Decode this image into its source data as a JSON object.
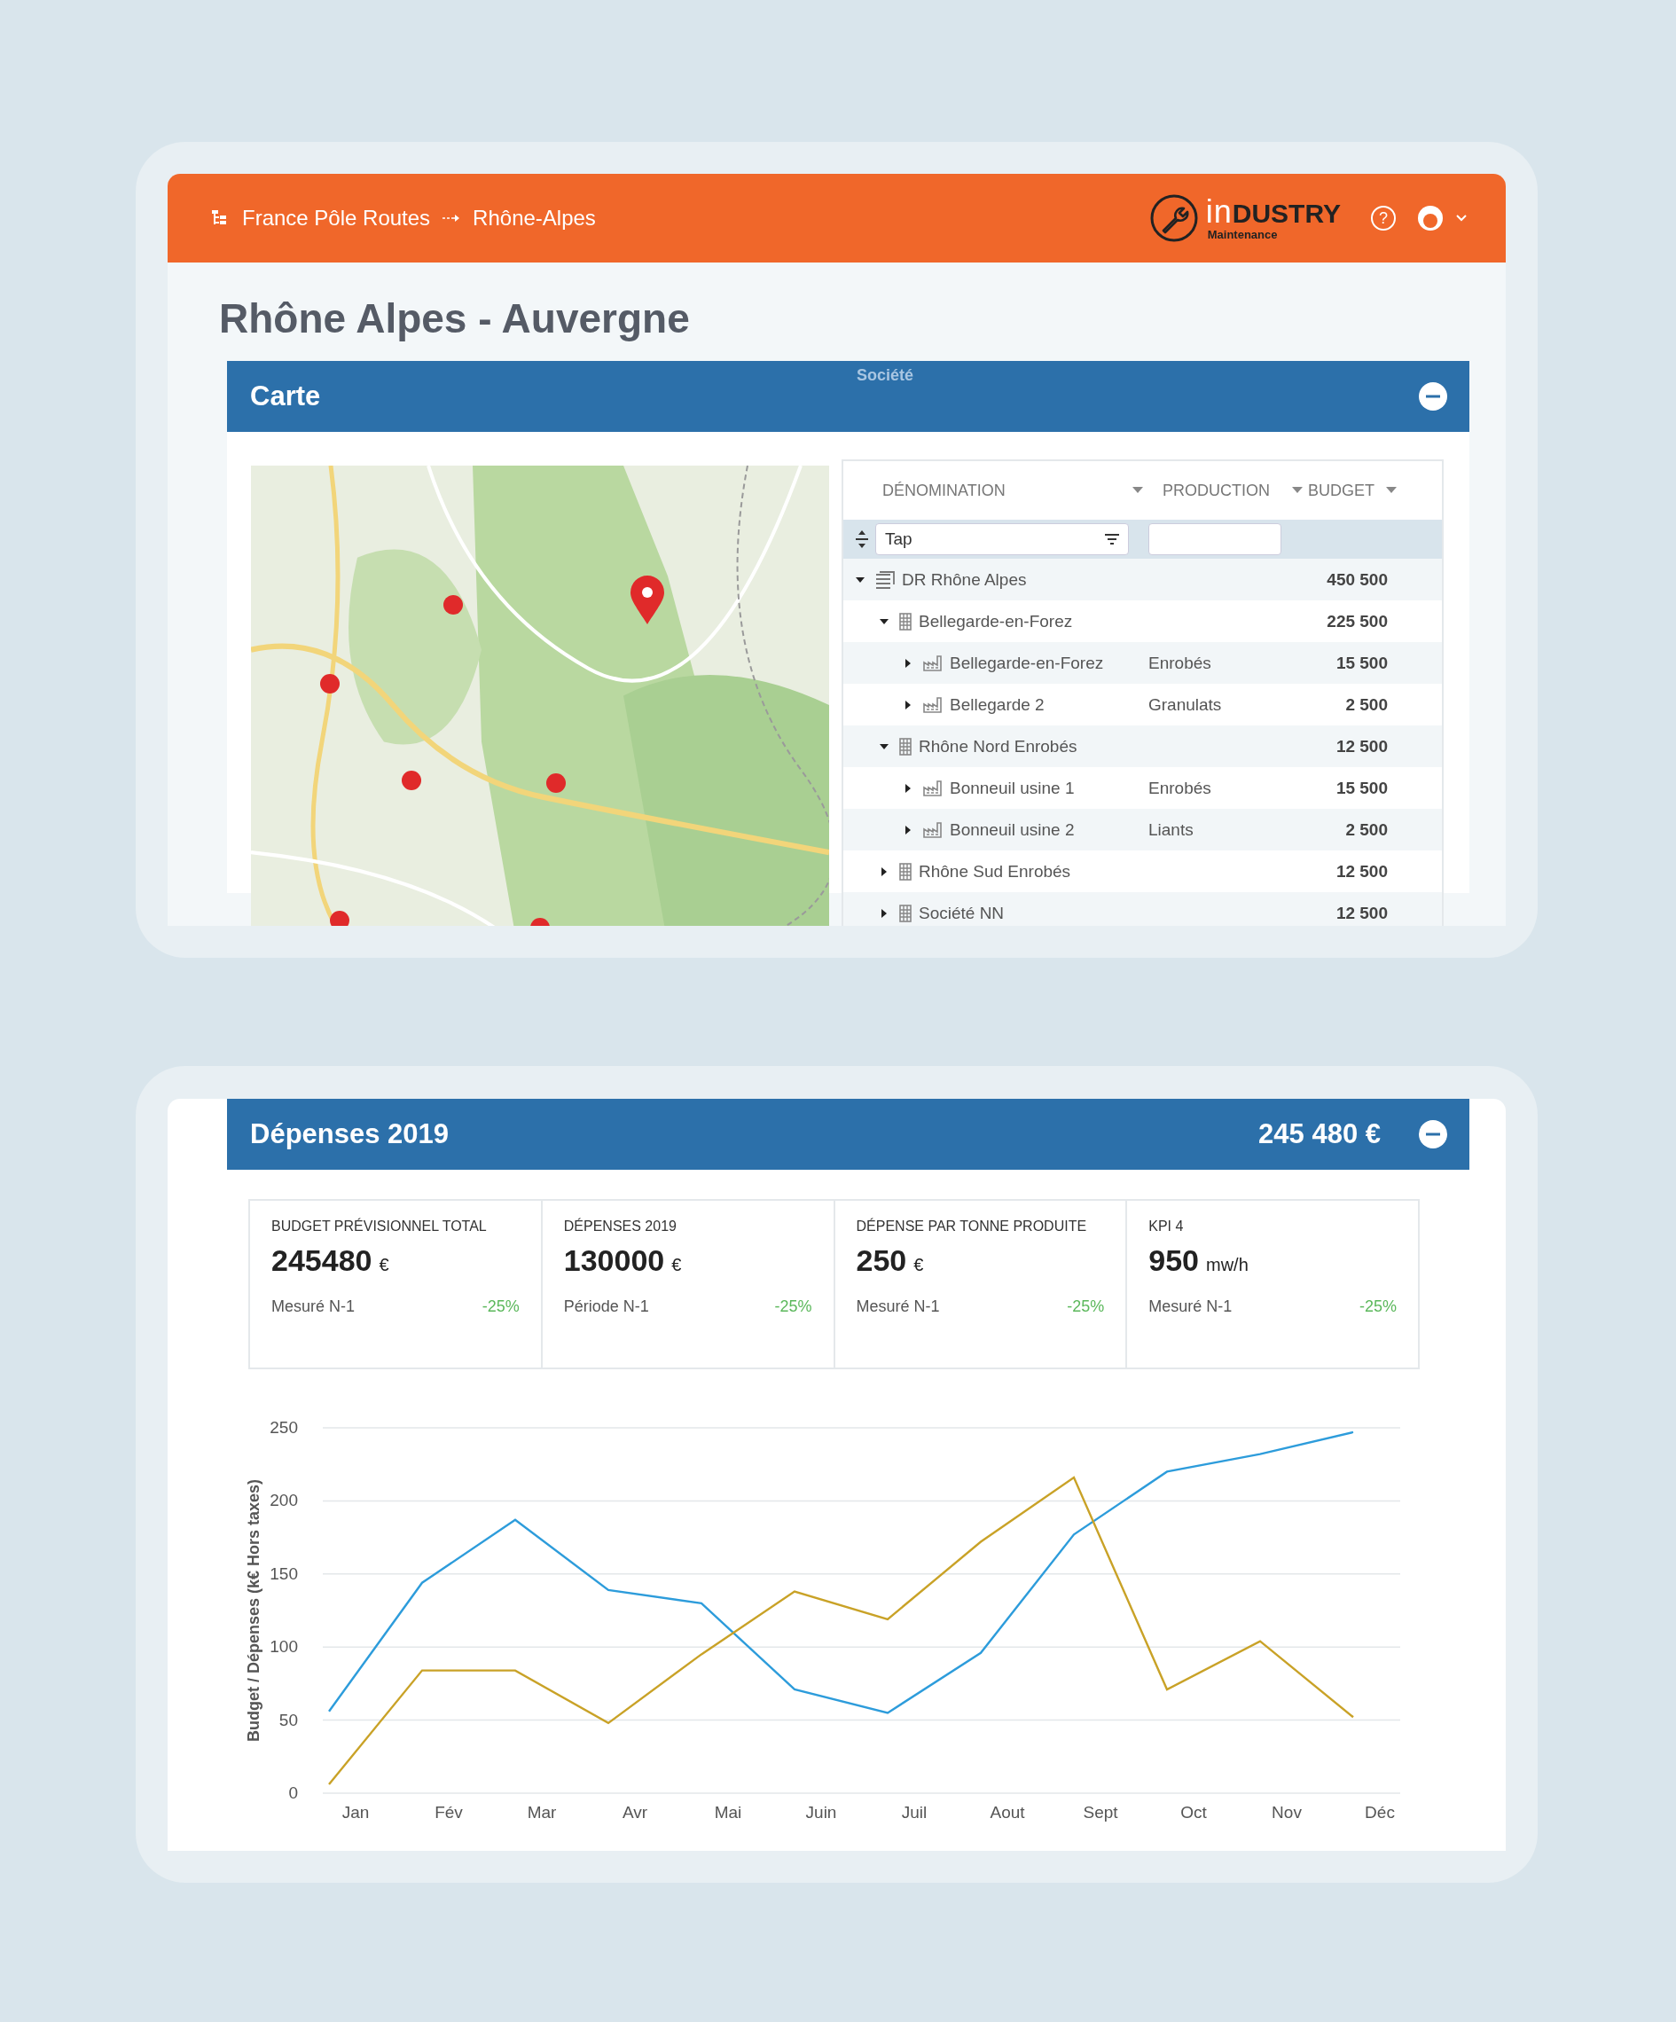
{
  "header": {
    "breadcrumb": [
      "France Pôle Routes",
      "Rhône-Alpes"
    ],
    "logo": {
      "prefix": "in",
      "name": "DUSTRY",
      "tagline": "Maintenance"
    },
    "help": "?"
  },
  "page_title": "Rhône Alpes - Auvergne",
  "carte": {
    "title": "Carte",
    "overlay_label": "Société",
    "expanded": true,
    "table": {
      "columns": [
        {
          "label": "DÉNOMINATION"
        },
        {
          "label": "PRODUCTION"
        },
        {
          "label": "BUDGET"
        }
      ],
      "filters": [
        {
          "kind": "menu",
          "value": "Tap"
        },
        {
          "kind": "plain"
        }
      ],
      "rows": [
        {
          "name": "DR Rhône Alpes",
          "budget": "450 500",
          "kind": "region",
          "expanded": true,
          "children": [
            {
              "name": "Bellegarde-en-Forez",
              "budget": "225 500",
              "kind": "company",
              "expanded": true,
              "children": [
                {
                  "name": "Bellegarde-en-Forez",
                  "production": "Enrobés",
                  "budget": "15 500",
                  "kind": "plant",
                  "expanded": false
                },
                {
                  "name": "Bellegarde 2",
                  "production": "Granulats",
                  "budget": "2 500",
                  "kind": "plant",
                  "expanded": false
                }
              ]
            },
            {
              "name": "Rhône Nord Enrobés",
              "budget": "12 500",
              "kind": "company",
              "expanded": true,
              "children": [
                {
                  "name": "Bonneuil usine 1",
                  "production": "Enrobés",
                  "budget": "15 500",
                  "kind": "plant",
                  "expanded": false
                },
                {
                  "name": "Bonneuil usine 2",
                  "production": "Liants",
                  "budget": "2 500",
                  "kind": "plant",
                  "expanded": false
                }
              ]
            },
            {
              "name": "Rhône Sud Enrobés",
              "budget": "12 500",
              "kind": "company",
              "expanded": false
            },
            {
              "name": "Société NN",
              "budget": "12 500",
              "kind": "company",
              "expanded": false
            }
          ]
        }
      ]
    }
  },
  "depenses": {
    "title": "Dépenses 2019",
    "total": "245 480 €",
    "expanded": true,
    "kpis": [
      {
        "label": "BUDGET PRÉVISIONNEL TOTAL",
        "value": "245480",
        "unit": "€",
        "basis": "Mesuré N-1",
        "change": "-25%"
      },
      {
        "label": "DÉPENSES 2019",
        "value": "130000",
        "unit": "€",
        "basis": "Période N-1",
        "change": "-25%"
      },
      {
        "label": "DÉPENSE PAR TONNE PRODUITE",
        "value": "250",
        "unit": "€",
        "basis": "Mesuré N-1",
        "change": "-25%"
      },
      {
        "label": "KPI 4",
        "value": "950",
        "unit": "mw/h",
        "basis": "Mesuré N-1",
        "change": "-25%"
      }
    ],
    "chart_data": {
      "type": "line",
      "ylabel": "Budget / Dépenses (k€ Hors taxes)",
      "categories": [
        "Jan",
        "Fév",
        "Mar",
        "Avr",
        "Mai",
        "Juin",
        "Juil",
        "Aout",
        "Sept",
        "Oct",
        "Nov",
        "Déc"
      ],
      "ylim": [
        0,
        250
      ],
      "grid": true,
      "yticks": [
        0,
        50,
        100,
        150,
        200,
        250
      ],
      "series": [
        {
          "color": "#2d9cdb",
          "values": [
            56,
            144,
            187,
            139,
            130,
            71,
            55,
            96,
            177,
            220,
            232,
            247
          ]
        },
        {
          "color": "#c9a227",
          "values": [
            6,
            84,
            84,
            48,
            95,
            138,
            119,
            172,
            216,
            71,
            104,
            52
          ]
        }
      ]
    }
  }
}
